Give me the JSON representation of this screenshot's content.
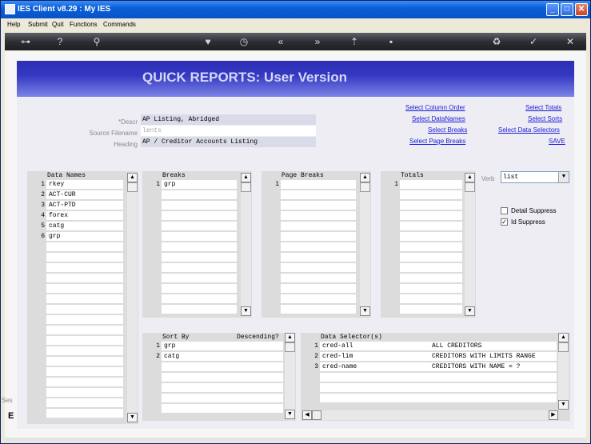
{
  "window": {
    "title": "IES Client v8.29 : My IES"
  },
  "menu": {
    "items": [
      "Help",
      "Submit",
      "Quit",
      "Functions",
      "Commands"
    ]
  },
  "toolbar": {
    "icons": [
      "key-icon",
      "help-icon",
      "search-icon",
      "heart-icon",
      "clock-icon",
      "back-icon",
      "forward-icon",
      "upload-icon",
      "stop-icon",
      "recycle-icon",
      "check-icon",
      "close-icon"
    ]
  },
  "page": {
    "title": "QUICK REPORTS: User Version"
  },
  "form": {
    "descr_label": "*Descr",
    "descr_value": "AP Listing, Abridged",
    "source_label": "Source Filename",
    "source_value": "lents",
    "heading_label": "Heading",
    "heading_value": "AP / Creditor Accounts Listing"
  },
  "links": {
    "select_column_order": "Select Column Order",
    "select_totals": "Select Totals",
    "select_datanames": "Select DataNames",
    "select_sorts": "Select Sorts",
    "select_breaks": "Select Breaks",
    "select_data_selectors": "Select Data Selectors",
    "select_page_breaks": "Select Page Breaks",
    "save": "SAVE"
  },
  "data_names": {
    "header": "Data Names",
    "rows": [
      {
        "n": "1",
        "v": "rkey"
      },
      {
        "n": "2",
        "v": "ACT-CUR"
      },
      {
        "n": "3",
        "v": "ACT-PTD"
      },
      {
        "n": "4",
        "v": "forex"
      },
      {
        "n": "5",
        "v": "catg"
      },
      {
        "n": "6",
        "v": "grp"
      }
    ]
  },
  "breaks": {
    "header": "Breaks",
    "rows": [
      {
        "n": "1",
        "v": "grp"
      }
    ]
  },
  "page_breaks": {
    "header": "Page Breaks",
    "rows": [
      {
        "n": "1",
        "v": ""
      }
    ]
  },
  "totals": {
    "header": "Totals",
    "rows": [
      {
        "n": "1",
        "v": ""
      }
    ]
  },
  "verb": {
    "label": "Verb",
    "value": "list"
  },
  "options": {
    "detail_suppress": {
      "label": "Detail Suppress",
      "checked": false
    },
    "id_suppress": {
      "label": "Id Suppress",
      "checked": true
    }
  },
  "sort_by": {
    "header": "Sort By",
    "header2": "Descending?",
    "rows": [
      {
        "n": "1",
        "v": "grp"
      },
      {
        "n": "2",
        "v": "catg"
      }
    ]
  },
  "data_selectors": {
    "header": "Data Selector(s)",
    "rows": [
      {
        "n": "1",
        "v": "cred-all",
        "d": "ALL CREDITORS"
      },
      {
        "n": "2",
        "v": "cred-lim",
        "d": "CREDITORS WITH LIMITS RANGE"
      },
      {
        "n": "3",
        "v": "cred-name",
        "d": "CREDITORS WITH NAME = ?"
      }
    ]
  },
  "left_fragment": {
    "text1": "Ses",
    "text2": "E"
  }
}
